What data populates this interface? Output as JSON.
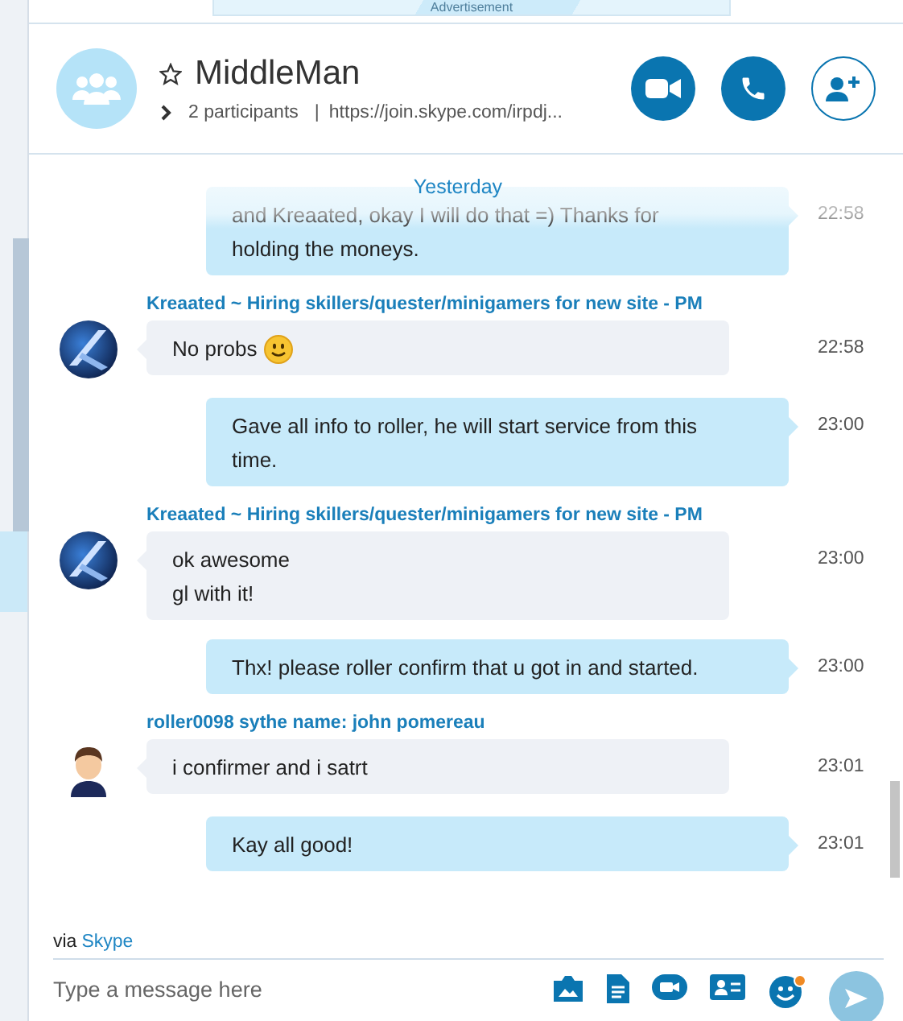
{
  "advertisement": {
    "label": "Advertisement"
  },
  "conversation": {
    "title": "MiddleMan",
    "favorite": false,
    "participants": "2 participants",
    "separator": "|",
    "link": "https://join.skype.com/irpdj..."
  },
  "call_buttons": [
    {
      "kind": "video"
    },
    {
      "kind": "call"
    },
    {
      "kind": "add-person"
    }
  ],
  "date_divider": "Yesterday",
  "messages": [
    {
      "kind": "sent",
      "paragraphs": [
        "and Kreaated, okay I will do that =) Thanks for holding the moneys."
      ],
      "time": "22:58"
    },
    {
      "kind": "received",
      "sender": "Kreaated ~ Hiring skillers/quester/minigamers for new site - PM",
      "avatar": {
        "kind": "logo"
      },
      "paragraphs": [
        "No probs"
      ],
      "emoticon": {
        "kind": "smile"
      },
      "time": "22:58"
    },
    {
      "kind": "sent",
      "paragraphs": [
        "Gave all info to roller, he will start service from this time."
      ],
      "time": "23:00"
    },
    {
      "kind": "received",
      "sender": "Kreaated ~ Hiring skillers/quester/minigamers for new site - PM",
      "avatar": {
        "kind": "logo"
      },
      "paragraphs": [
        "ok awesome",
        "gl with it!"
      ],
      "time": "23:00"
    },
    {
      "kind": "sent",
      "paragraphs": [
        "Thx! please roller confirm that u got in and started."
      ],
      "time": "23:00"
    },
    {
      "kind": "received",
      "sender": "roller0098 sythe name: john pomereau",
      "avatar": {
        "kind": "figure"
      },
      "paragraphs": [
        "i confirmer and i satrt"
      ],
      "time": "23:01"
    },
    {
      "kind": "sent",
      "paragraphs": [
        "Kay all good!"
      ],
      "time": "23:01"
    }
  ],
  "footer": {
    "via": "via",
    "service": "Skype",
    "placeholder": "Type a message here"
  },
  "composer_tools": [
    {
      "kind": "media"
    },
    {
      "kind": "file"
    },
    {
      "kind": "video-message"
    },
    {
      "kind": "contact"
    },
    {
      "kind": "emoticon",
      "notification": true
    }
  ]
}
